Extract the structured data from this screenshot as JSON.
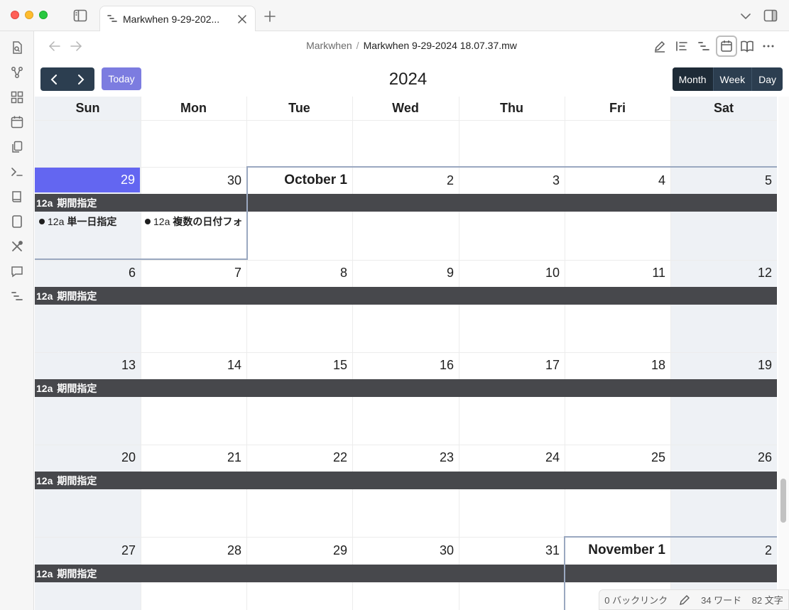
{
  "tab": {
    "label": "Markwhen 9-29-202..."
  },
  "breadcrumb": {
    "parent": "Markwhen",
    "separator": "/",
    "file": "Markwhen 9-29-2024 18.07.37.mw"
  },
  "toolbar": {
    "today_label": "Today",
    "title": "2024",
    "views": [
      "Month",
      "Week",
      "Day"
    ],
    "active_view": "Month"
  },
  "calendar": {
    "weekdays": [
      "Sun",
      "Mon",
      "Tue",
      "Wed",
      "Thu",
      "Fri",
      "Sat"
    ],
    "weeks": [
      [
        "",
        "",
        "",
        "",
        "",
        "",
        ""
      ],
      [
        "29",
        "30",
        "October 1",
        "2",
        "3",
        "4",
        "5"
      ],
      [
        "6",
        "7",
        "8",
        "9",
        "10",
        "11",
        "12"
      ],
      [
        "13",
        "14",
        "15",
        "16",
        "17",
        "18",
        "19"
      ],
      [
        "20",
        "21",
        "22",
        "23",
        "24",
        "25",
        "26"
      ],
      [
        "27",
        "28",
        "29",
        "30",
        "31",
        "November 1",
        "2"
      ]
    ],
    "span_event": {
      "time": "12a",
      "title": "期間指定"
    },
    "single_events": [
      {
        "time": "12a",
        "title": "単一日指定"
      },
      {
        "time": "12a",
        "title": "複数の日付フォ"
      }
    ]
  },
  "status": {
    "backlinks": "0 バックリンク",
    "words": "34 ワード",
    "chars": "82 文字"
  },
  "colors": {
    "nav_button": "#2c3e50",
    "today_button": "#7c7ce0",
    "today_cell": "#6366f1",
    "event_bar": "#47484c",
    "weekend": "#eef1f5"
  }
}
